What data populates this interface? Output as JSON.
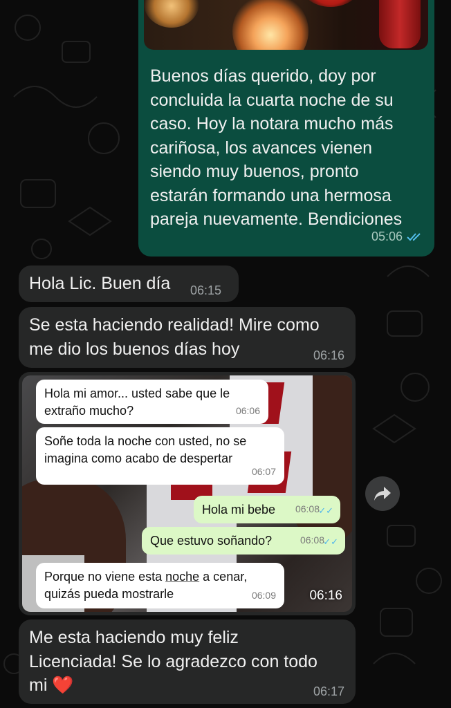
{
  "messages": [
    {
      "id": "out-1",
      "direction": "outgoing",
      "has_photo": true,
      "text": "Buenos días querido, doy por\nconcluida la cuarta noche de su\ncaso. Hoy la notara mucho más\ncariñosa, los avances vienen\nsiendo muy buenos, pronto\nestarán formando una hermosa\npareja nuevamente. Bendiciones",
      "time": "05:06",
      "status": "read"
    },
    {
      "id": "in-1",
      "direction": "incoming",
      "text": "Hola Lic. Buen día",
      "time": "06:15"
    },
    {
      "id": "in-2",
      "direction": "incoming",
      "text": "Se esta haciendo realidad! Mire como\nme dio los buenos días hoy",
      "time": "06:16"
    },
    {
      "id": "in-3",
      "direction": "incoming",
      "type": "image",
      "time": "06:16"
    },
    {
      "id": "in-4",
      "direction": "incoming",
      "text": "Me esta haciendo muy feliz\nLicenciada! Se lo agradezco con todo\nmi ❤️",
      "time": "06:17"
    }
  ],
  "screenshot": {
    "bubbles": [
      {
        "side": "in",
        "text": "Hola mi amor... usted sabe que le\nextraño mucho?",
        "time": "06:06"
      },
      {
        "side": "in",
        "text": "Soñe toda la noche con usted, no se\nimagina como acabo de despertar",
        "time": "06:07"
      },
      {
        "side": "out",
        "text": "Hola mi bebe",
        "time": "06:08"
      },
      {
        "side": "out",
        "text": "Que estuvo soñando?",
        "time": "06:08"
      },
      {
        "side": "in",
        "text_before": "Porque no viene esta ",
        "text_underlined": "noche",
        "text_after": " a cenar,\nquizás pueda mostrarle",
        "time": "06:09"
      }
    ]
  },
  "colors": {
    "outgoing_bubble": "#0b4d3f",
    "incoming_bubble": "#262727",
    "read_ticks": "#53bdeb",
    "background": "#0b0b0b"
  },
  "icons": {
    "forward": "forward-arrow-icon",
    "read": "double-check-icon"
  }
}
